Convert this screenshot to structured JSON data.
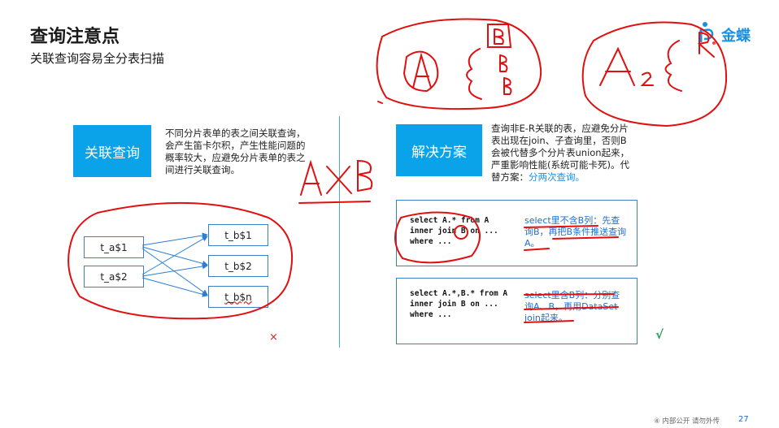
{
  "header": {
    "title": "查询注意点",
    "subtitle": "关联查询容易全分表扫描",
    "logo_text": "金蝶"
  },
  "left": {
    "box_label": "关联查询",
    "description": "不同分片表单的表之间关联查询，会产生笛卡尔积，产生性能问题的概率较大，应避免分片表单的表之间进行关联查询。",
    "tables_a": [
      "t_a$1",
      "t_a$2"
    ],
    "tables_b": [
      "t_b$1",
      "t_b$2",
      "t_b$n"
    ],
    "mark": "×"
  },
  "right": {
    "box_label": "解决方案",
    "description_main": "查询非E-R关联的表，应避免分片表出现在join、子查询里，否则B会被代替多个分片表union起来，严重影响性能(系统可能卡死)。代替方案：",
    "description_highlight": "分两次查询。",
    "panel1": {
      "code": "select A.* from A\ninner join B on ...\nwhere ...",
      "note": "select里不含B列：先查询B，再把B条件推送查询A。"
    },
    "panel2": {
      "code": "select A.*,B.* from A\ninner join B on ...\nwhere ...",
      "note": "select里含B列：分别查询A、B，再用DataSet join起来。"
    },
    "mark": "√"
  },
  "footer": {
    "text": "④ 内部公开 请勿外传",
    "page": "27"
  },
  "colors": {
    "accent_blue": "#0aa2e8",
    "annotation_red": "#e01010",
    "divider": "#3fb6c8",
    "note_blue": "#1d6fd0"
  }
}
